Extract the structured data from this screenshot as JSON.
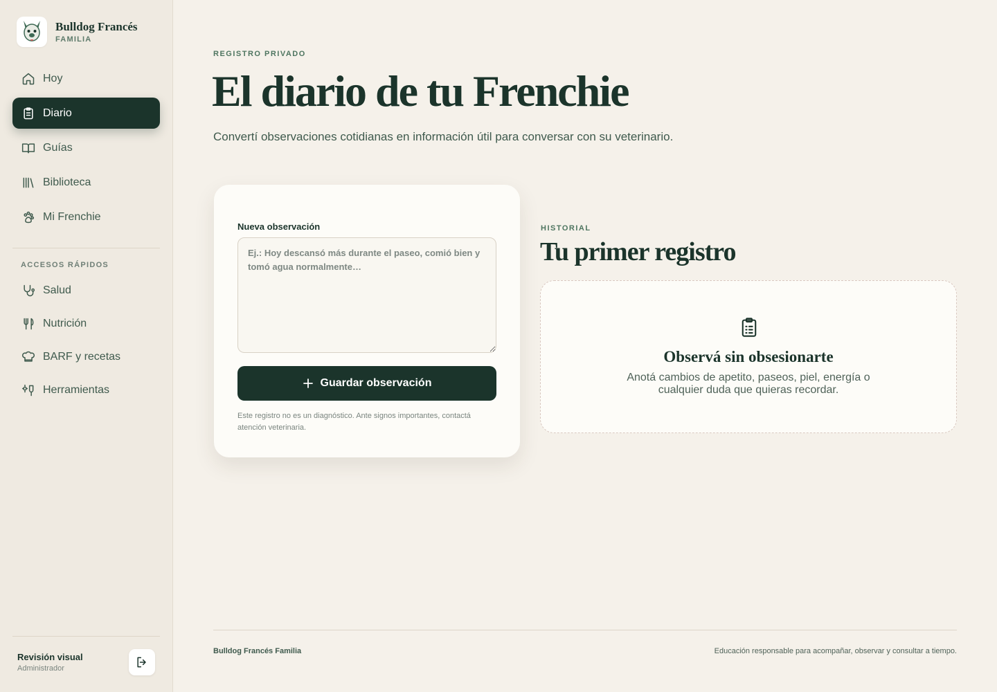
{
  "brand": {
    "title": "Bulldog Francés",
    "subtitle": "FAMILIA",
    "logo_icon": "bulldog-face-icon"
  },
  "sidebar": {
    "items": [
      {
        "label": "Hoy",
        "icon": "home-icon",
        "active": false
      },
      {
        "label": "Diario",
        "icon": "clipboard-icon",
        "active": true
      },
      {
        "label": "Guías",
        "icon": "book-icon",
        "active": false
      },
      {
        "label": "Biblioteca",
        "icon": "library-icon",
        "active": false
      },
      {
        "label": "Mi Frenchie",
        "icon": "paw-icon",
        "active": false
      }
    ],
    "quick_title": "ACCESOS RÁPIDOS",
    "quick_items": [
      {
        "label": "Salud",
        "icon": "stethoscope-icon"
      },
      {
        "label": "Nutrición",
        "icon": "utensils-icon"
      },
      {
        "label": "BARF y recetas",
        "icon": "chef-hat-icon"
      },
      {
        "label": "Herramientas",
        "icon": "tools-icon"
      }
    ],
    "user": {
      "name": "Revisión visual",
      "role": "Administrador"
    },
    "logout_icon": "logout-icon"
  },
  "hero": {
    "eyebrow": "REGISTRO PRIVADO",
    "title": "El diario de tu Frenchie",
    "subtitle": "Convertí observaciones cotidianas en información útil para conversar con su veterinario."
  },
  "form": {
    "label": "Nueva observación",
    "placeholder": "Ej.: Hoy descansó más durante el paseo, comió bien y tomó agua normalmente…",
    "value": "",
    "save_label": "Guardar observación",
    "disclaimer": "Este registro no es un diagnóstico. Ante signos importantes, contactá atención veterinaria."
  },
  "history": {
    "eyebrow": "HISTORIAL",
    "title": "Tu primer registro",
    "empty_title": "Observá sin obsesionarte",
    "empty_text": "Anotá cambios de apetito, paseos, piel, energía o cualquier duda que quieras recordar."
  },
  "footer": {
    "left": "Bulldog Francés Familia",
    "right": "Educación responsable para acompañar, observar y consultar a tiempo."
  },
  "colors": {
    "accent": "#1b342b",
    "background": "#f5f1ea",
    "sidebar": "#efeae1",
    "card": "#fdfcf8"
  }
}
